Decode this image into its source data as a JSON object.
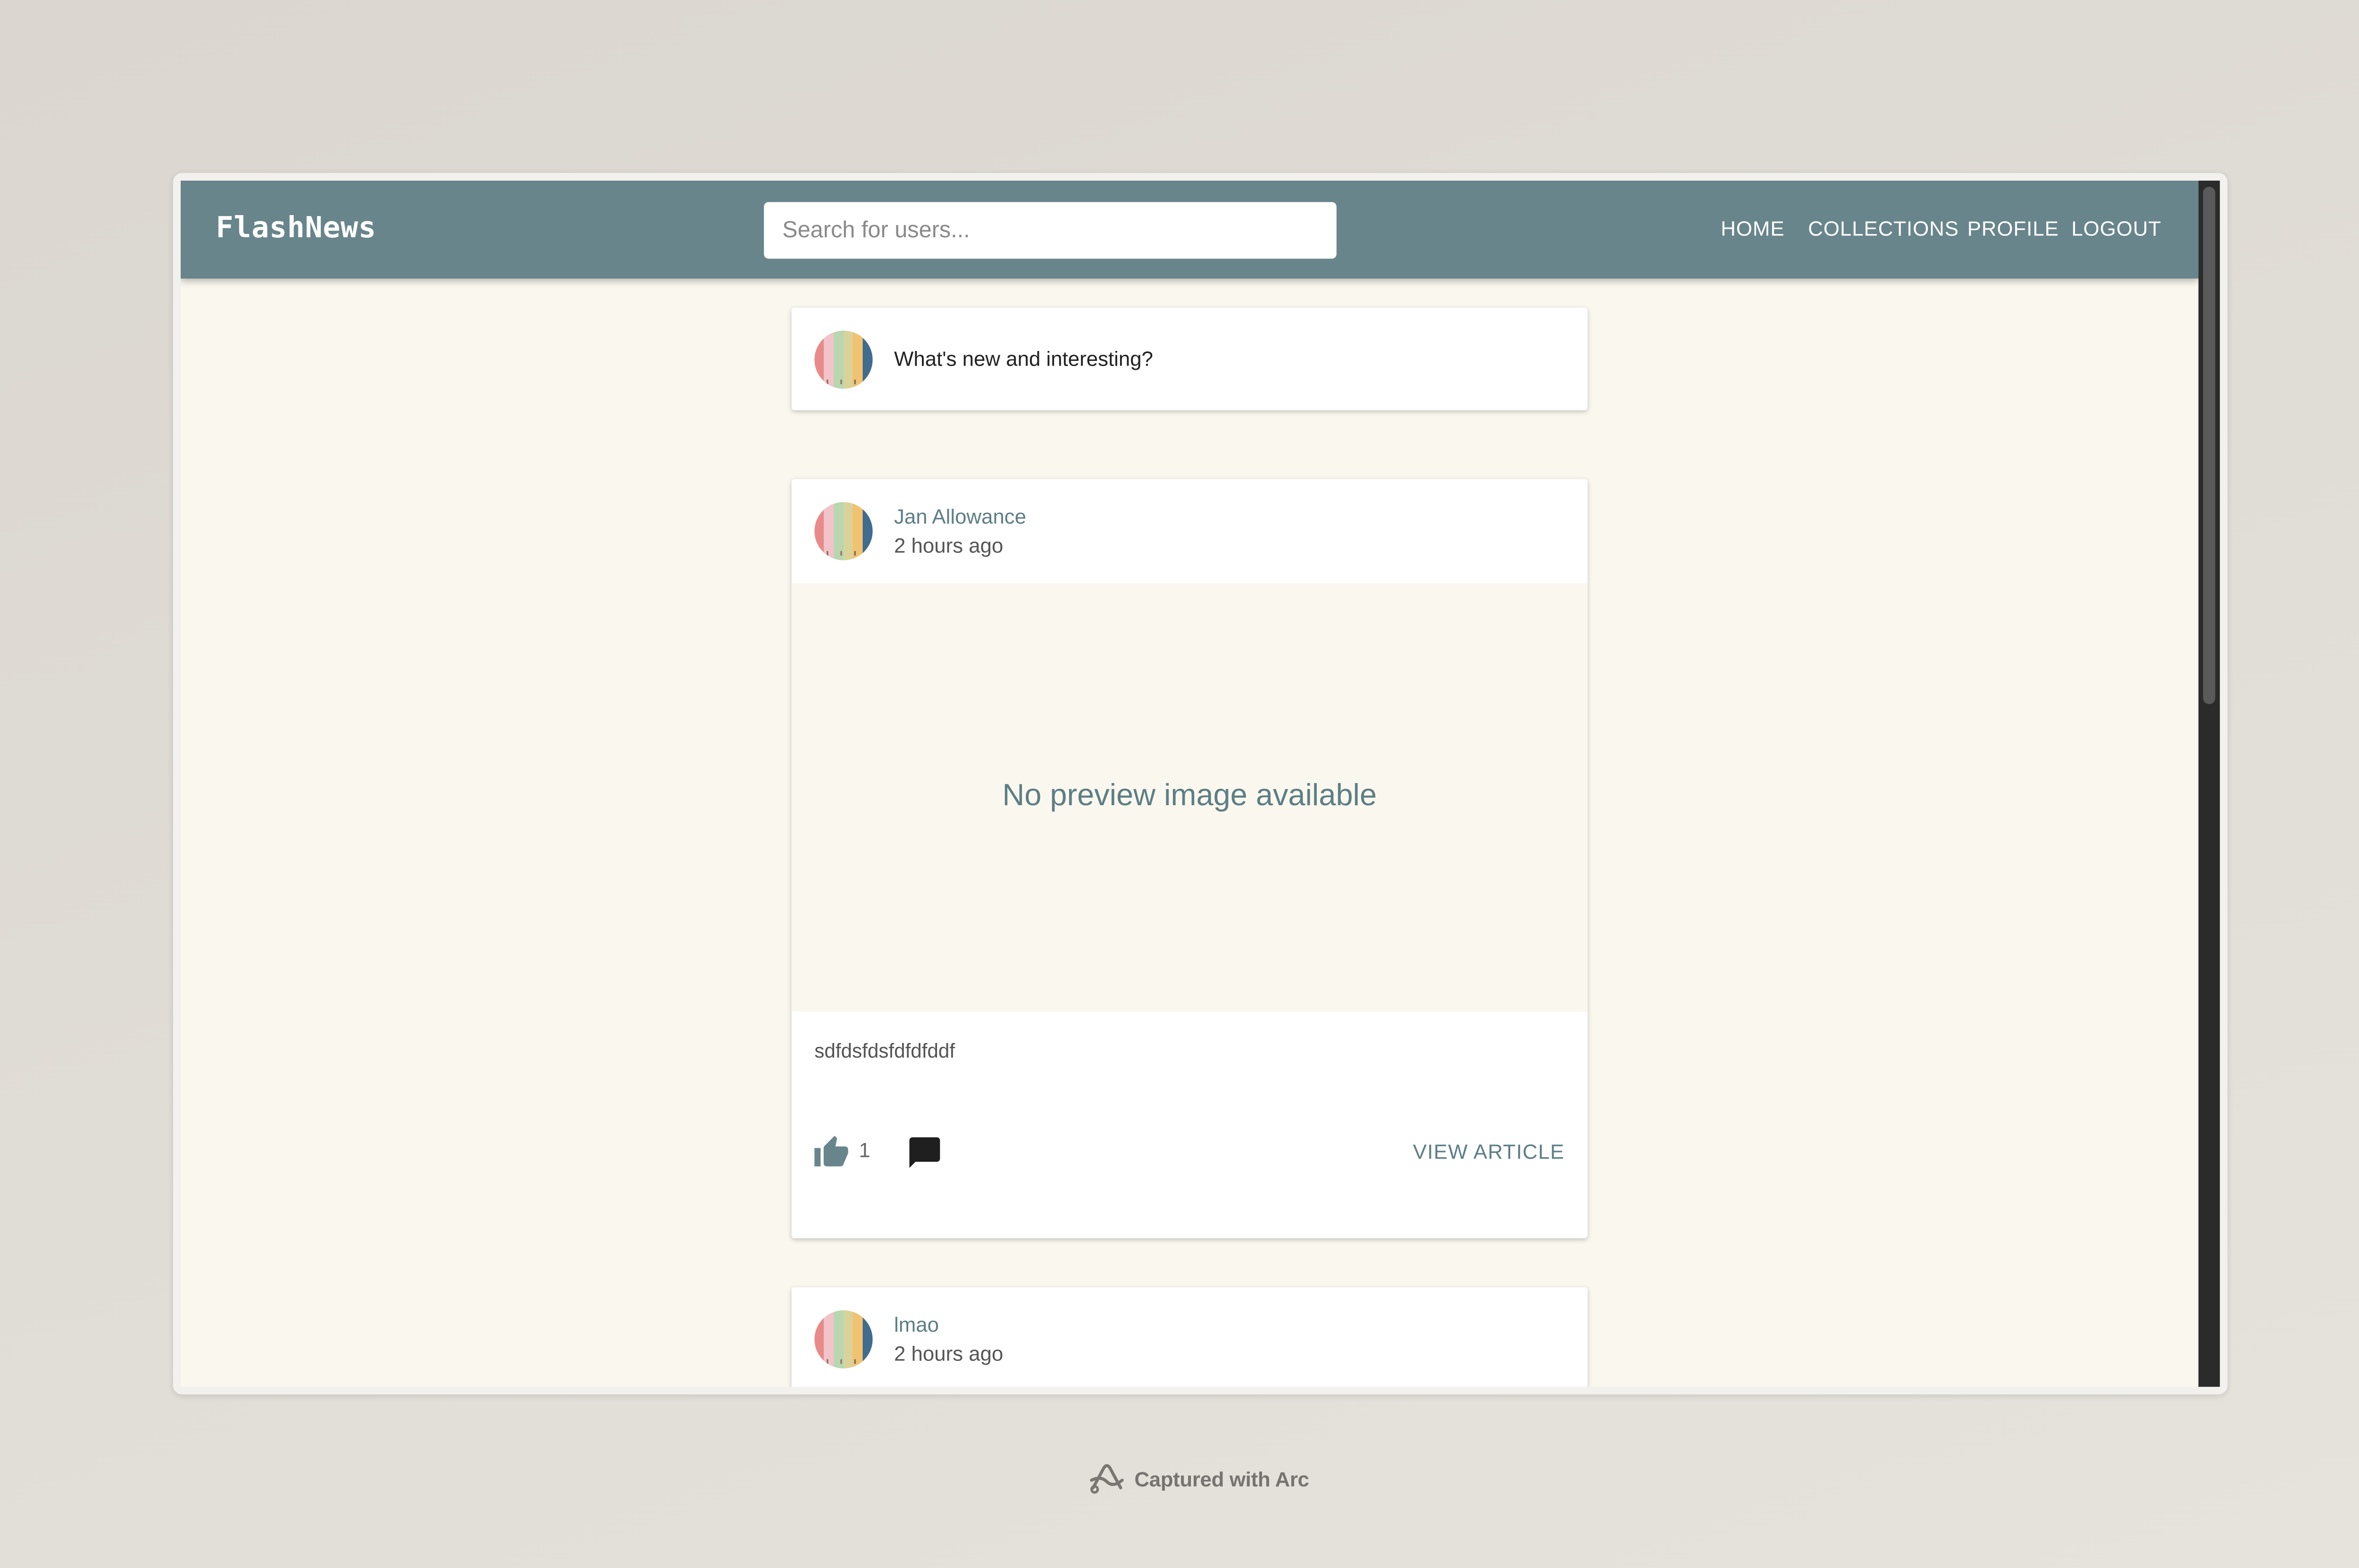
{
  "app": {
    "brand": "FlashNews"
  },
  "search": {
    "placeholder": "Search for users..."
  },
  "nav": {
    "items": [
      {
        "label": "HOME"
      },
      {
        "label": "COLLECTIONS"
      },
      {
        "label": "PROFILE"
      },
      {
        "label": "LOGOUT"
      }
    ]
  },
  "composer": {
    "prompt": "What's new and interesting?"
  },
  "posts": [
    {
      "author": "Jan Allowance",
      "time": "2 hours ago",
      "preview_text": "No preview image available",
      "body": "sdfdsfdsfdfdfddf",
      "likes": "1",
      "action_label": "VIEW ARTICLE"
    },
    {
      "author": "lmao",
      "time": "2 hours ago"
    }
  ],
  "footer": {
    "caption": "Captured with Arc"
  },
  "colors": {
    "appbar": "#68858c",
    "accent": "#5d7e86",
    "page_background": "#faf8ee"
  }
}
